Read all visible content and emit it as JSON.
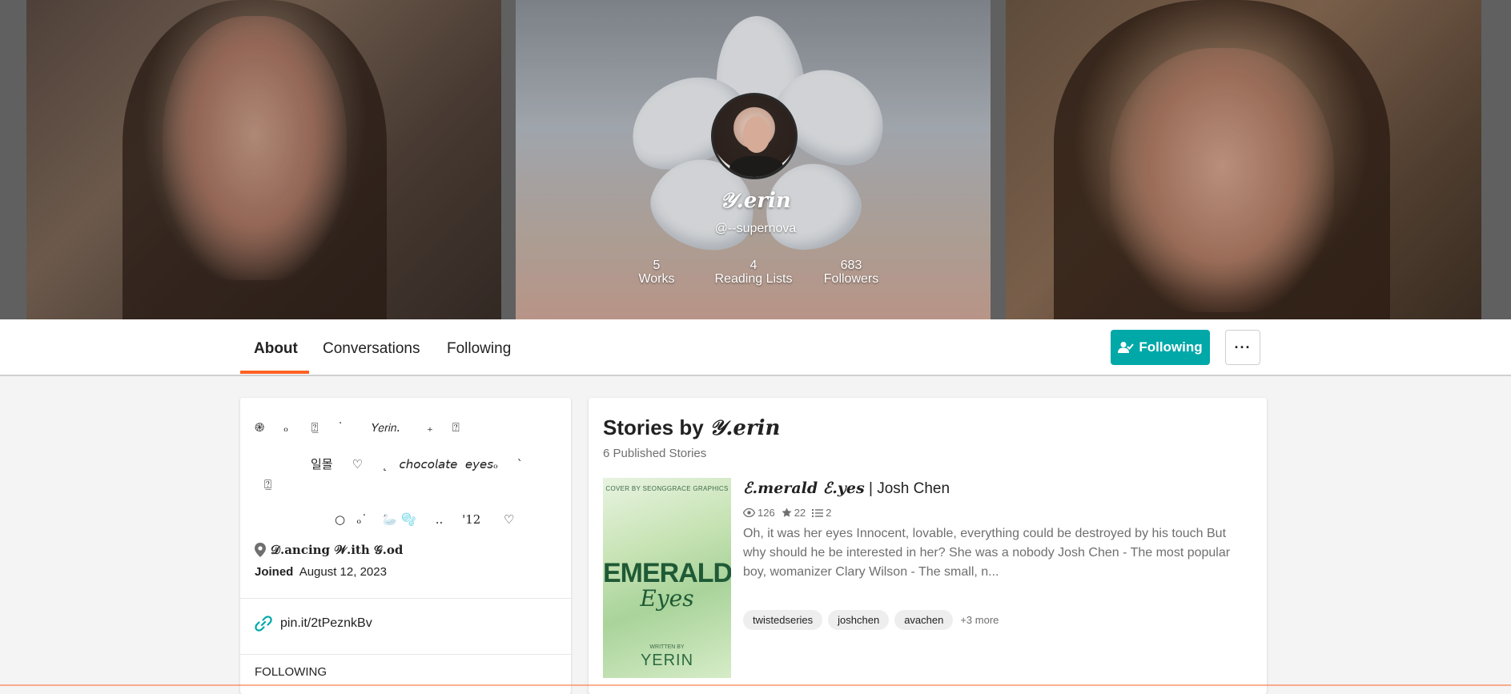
{
  "profile": {
    "display_name": "𝒴.erin",
    "username": "@--supernova",
    "stats": [
      {
        "value": "5",
        "label": "Works"
      },
      {
        "value": "4",
        "label": "Reading Lists"
      },
      {
        "value": "683",
        "label": "Followers"
      }
    ]
  },
  "tabs": {
    "about": "About",
    "conversations": "Conversations",
    "following": "Following"
  },
  "actions": {
    "follow_label": "Following",
    "more_label": "···"
  },
  "about": {
    "bio_lines": [
      "֎     ₒ      ⍰̲     ˙       𝘠𝘦𝘳𝘪𝘯.       ₊     ⍰",
      "일몰     ♡     ˛   𝘤𝘩𝘰𝘤𝘰𝘭𝘢𝘵𝘦  𝘦𝘺𝘦𝘴ₒ     ˋ",
      "⍰̲",
      "○   ₒ˙    🦢 🫧     ..     '12      ♡"
    ],
    "location": "𝒟.ancing 𝒲.ith 𝒢.od",
    "joined_label": "Joined",
    "joined_date": "August 12, 2023",
    "link": "pin.it/2tPeznkBv",
    "following_heading": "FOLLOWING"
  },
  "stories": {
    "title_prefix": "Stories by ",
    "title_name": "𝒴.erin",
    "count_text": "6 Published Stories",
    "items": [
      {
        "title_fancy": "ℰ.merald ℰ.yes",
        "title_rest": " | Josh Chen",
        "reads": "126",
        "votes": "22",
        "parts": "2",
        "description": "Oh, it was her eyes Innocent, lovable, everything could be destroyed by his touch But why should he be interested in her? She was a nobody Josh Chen - The most popular boy, womanizer Clary Wilson - The small, n...",
        "tags": [
          "twistedseries",
          "joshchen",
          "avachen"
        ],
        "more_tags": "+3 more",
        "cover": {
          "top_text": "COVER BY SEONGGRACE GRAPHICS",
          "title": "EMERALD",
          "subtitle": "Eyes",
          "written_by": "WRITTEN BY",
          "author": "YERIN"
        }
      }
    ]
  },
  "colors": {
    "accent_orange": "#ff6122",
    "follow_teal": "#00a8a8"
  }
}
